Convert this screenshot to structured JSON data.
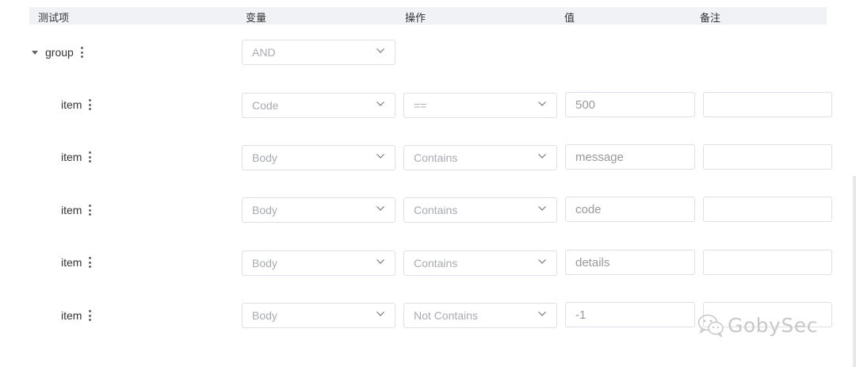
{
  "header": {
    "test_item": "测试项",
    "variable": "变量",
    "operation": "操作",
    "value": "值",
    "note": "备注"
  },
  "group": {
    "label": "group",
    "logic": "AND"
  },
  "items": [
    {
      "label": "item",
      "variable": "Code",
      "operator": "==",
      "value": "500",
      "note": ""
    },
    {
      "label": "item",
      "variable": "Body",
      "operator": "Contains",
      "value": "message",
      "note": ""
    },
    {
      "label": "item",
      "variable": "Body",
      "operator": "Contains",
      "value": "code",
      "note": ""
    },
    {
      "label": "item",
      "variable": "Body",
      "operator": "Contains",
      "value": "details",
      "note": ""
    },
    {
      "label": "item",
      "variable": "Body",
      "operator": "Not Contains",
      "value": "-1",
      "note": ""
    }
  ],
  "watermark": {
    "text": "GobySec",
    "icon": "wechat-icon"
  },
  "colors": {
    "header_bg": "#f0f2f5",
    "border": "#dcdfe6",
    "placeholder": "#a8abb2"
  }
}
